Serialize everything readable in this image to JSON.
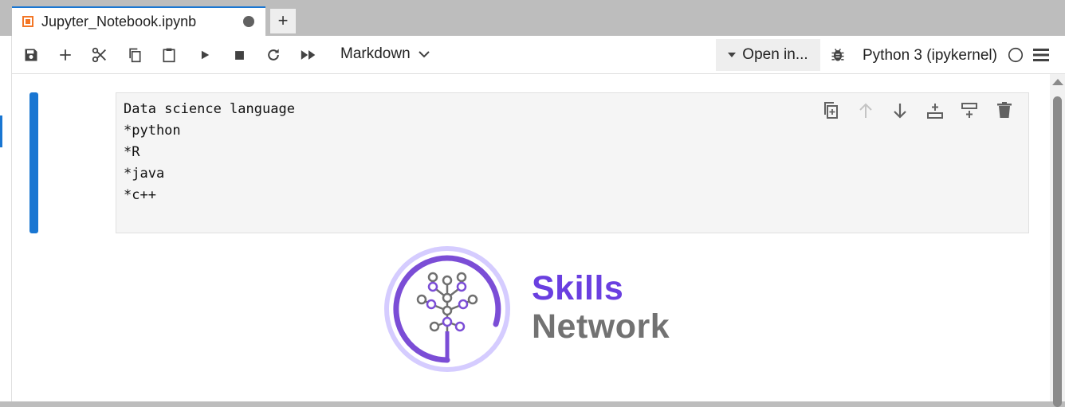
{
  "tab": {
    "title": "Jupyter_Notebook.ipynb",
    "new_tab_label": "+"
  },
  "toolbar": {
    "cell_type": "Markdown",
    "open_in_label": "Open in...",
    "kernel_name": "Python 3 (ipykernel)"
  },
  "cell": {
    "lines": [
      "Data science language",
      "*python",
      "*R",
      "*java",
      "*c++"
    ]
  },
  "logo": {
    "line1": "Skills",
    "line2": "Network"
  },
  "colors": {
    "accent": "#1976d2",
    "brand_purple": "#6a3fe0",
    "brand_gray": "#727272",
    "jupyter_orange": "#f37626"
  }
}
